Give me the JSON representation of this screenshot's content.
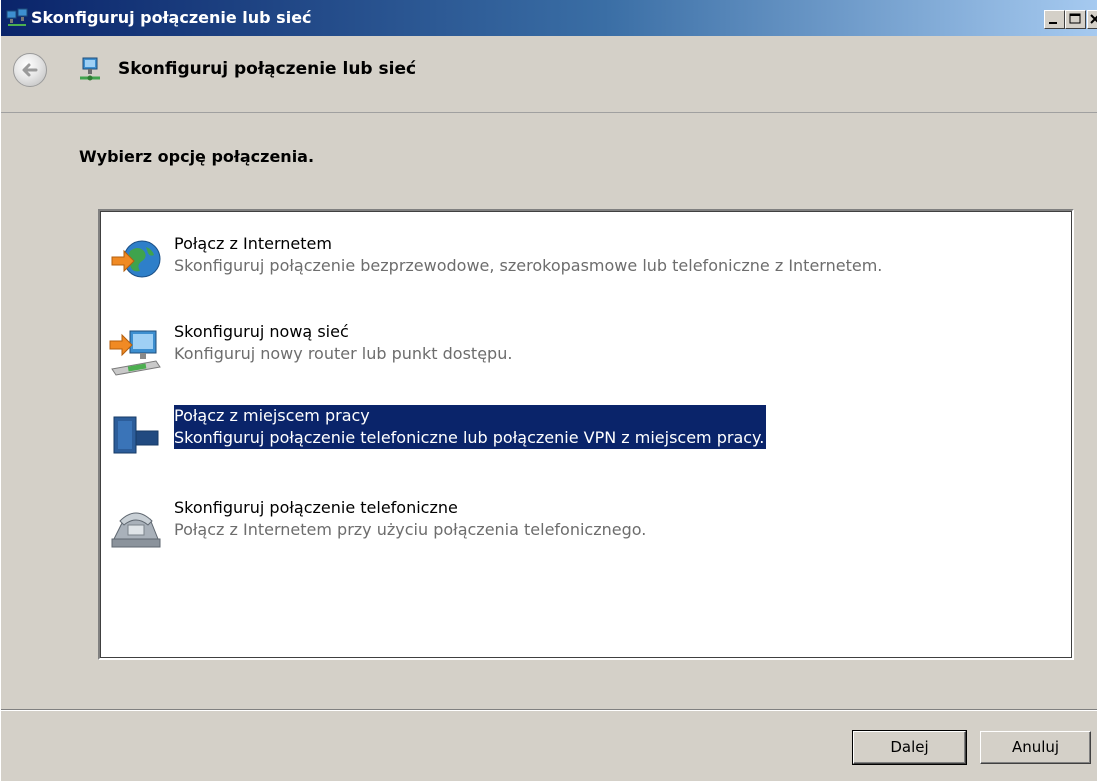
{
  "window": {
    "title": "Skonfiguruj połączenie lub sieć"
  },
  "header": {
    "title": "Skonfiguruj połączenie lub sieć"
  },
  "main": {
    "instruction": "Wybierz opcję połączenia.",
    "options": [
      {
        "icon": "globe-arrow-icon",
        "title": "Połącz z Internetem",
        "description": "Skonfiguruj połączenie bezprzewodowe, szerokopasmowe lub telefoniczne z Internetem.",
        "selected": false
      },
      {
        "icon": "network-router-icon",
        "title": "Skonfiguruj nową sieć",
        "description": "Konfiguruj nowy router lub punkt dostępu.",
        "selected": false
      },
      {
        "icon": "workplace-building-icon",
        "title": "Połącz z miejscem pracy",
        "description": "Skonfiguruj połączenie telefoniczne lub połączenie VPN z miejscem pracy.",
        "selected": true
      },
      {
        "icon": "telephone-icon",
        "title": "Skonfiguruj połączenie telefoniczne",
        "description": "Połącz z Internetem przy użyciu połączenia telefonicznego.",
        "selected": false
      }
    ]
  },
  "footer": {
    "next_label": "Dalej",
    "cancel_label": "Anuluj"
  },
  "colors": {
    "selection": "#0a246a",
    "face": "#d4d0c8",
    "description_text": "#6d6d6d"
  }
}
